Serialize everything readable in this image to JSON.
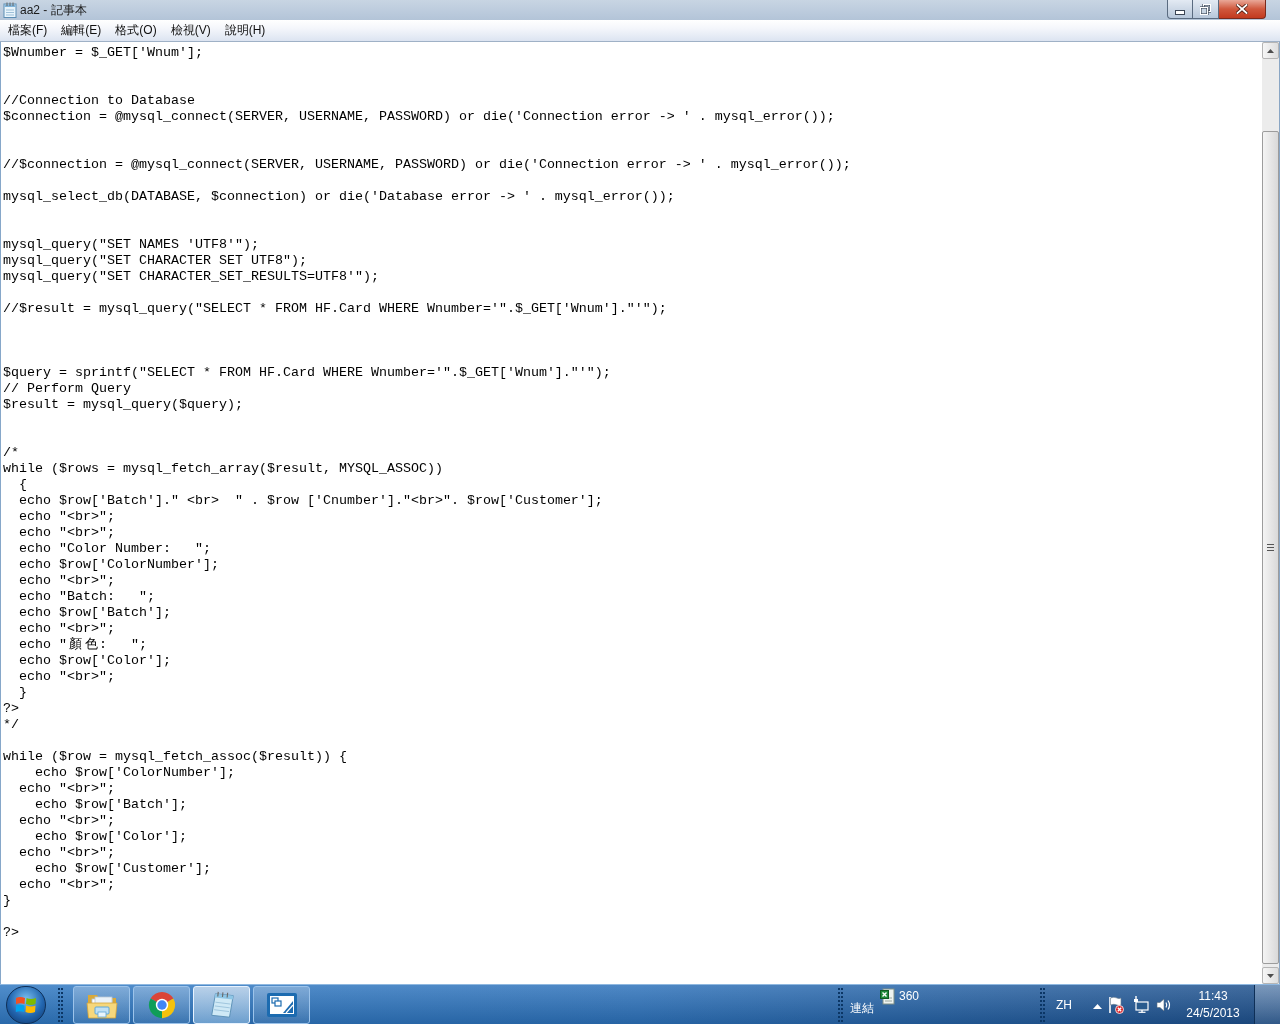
{
  "window": {
    "title": "aa2 - 記事本"
  },
  "menu": [
    "檔案(F)",
    "編輯(E)",
    "格式(O)",
    "檢視(V)",
    "說明(H)"
  ],
  "document": {
    "text": "$Wnumber = $_GET['Wnum'];\n\n\n//Connection to Database\n$connection = @mysql_connect(SERVER, USERNAME, PASSWORD) or die('Connection error -> ' . mysql_error());\n\n\n//$connection = @mysql_connect(SERVER, USERNAME, PASSWORD) or die('Connection error -> ' . mysql_error());\n\nmysql_select_db(DATABASE, $connection) or die('Database error -> ' . mysql_error());\n\n\nmysql_query(\"SET NAMES 'UTF8'\");\nmysql_query(\"SET CHARACTER SET UTF8\");\nmysql_query(\"SET CHARACTER_SET_RESULTS=UTF8'\");\n\n//$result = mysql_query(\"SELECT * FROM HF.Card WHERE Wnumber='\".$_GET['Wnum'].\"'\");\n\n\n\n$query = sprintf(\"SELECT * FROM HF.Card WHERE Wnumber='\".$_GET['Wnum'].\"'\");\n// Perform Query\n$result = mysql_query($query);\n\n\n/*\nwhile ($rows = mysql_fetch_array($result, MYSQL_ASSOC))\n  {\n  echo $row['Batch'].\" <br>  \" . $row ['Cnumber'].\"<br>\". $row['Customer'];\n  echo \"<br>\";\n  echo \"<br>\";\n  echo \"Color Number:   \";\n  echo $row['ColorNumber'];\n  echo \"<br>\";\n  echo \"Batch:   \";\n  echo $row['Batch'];\n  echo \"<br>\";\n  echo \"顏色:   \";\n  echo $row['Color'];\n  echo \"<br>\";\n  }\n?>\n*/\n\nwhile ($row = mysql_fetch_assoc($result)) {\n    echo $row['ColorNumber'];\n  echo \"<br>\";\n    echo $row['Batch'];\n  echo \"<br>\";\n    echo $row['Color'];\n  echo \"<br>\";\n    echo $row['Customer'];\n  echo \"<br>\";\n}\n\n?>"
  },
  "taskbar": {
    "buttons": [
      {
        "kind": "folder",
        "active": false
      },
      {
        "kind": "browser",
        "active": false
      },
      {
        "kind": "notepad",
        "active": true
      },
      {
        "kind": "remote",
        "active": false
      }
    ],
    "links_label": "連結",
    "toolbar_app_label": "360",
    "language": "ZH",
    "time": "11:43",
    "date": "24/5/2013"
  }
}
